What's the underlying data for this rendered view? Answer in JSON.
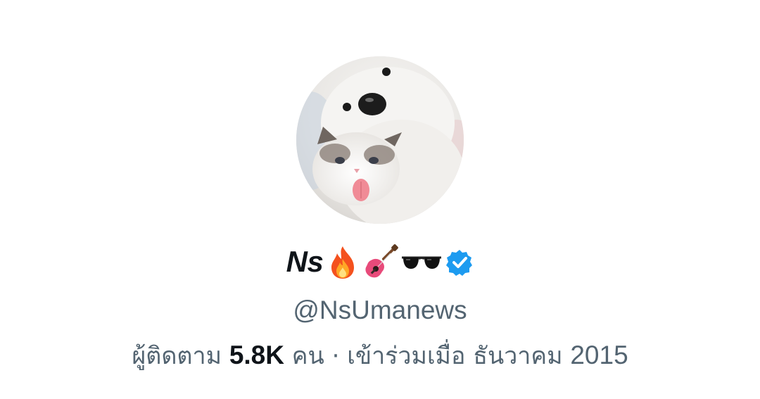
{
  "profile": {
    "display_name": "Ns",
    "name_emojis": [
      "fire-emoji",
      "guitar-emoji",
      "sunglasses-emoji"
    ],
    "verified": true,
    "handle": "@NsUmanews",
    "followers_label": "ผู้ติดตาม",
    "followers_count": "5.8K",
    "followers_unit": "คน",
    "separator": "·",
    "joined_label": "เข้าร่วมเมื่อ ธันวาคม",
    "joined_year": "2015"
  },
  "colors": {
    "text_primary": "#0f1419",
    "text_secondary": "#536471",
    "verified_blue": "#1d9bf0",
    "background": "#ffffff"
  },
  "icons": {
    "avatar": "dog-and-cat-photo",
    "verified": "verified-badge-icon"
  }
}
